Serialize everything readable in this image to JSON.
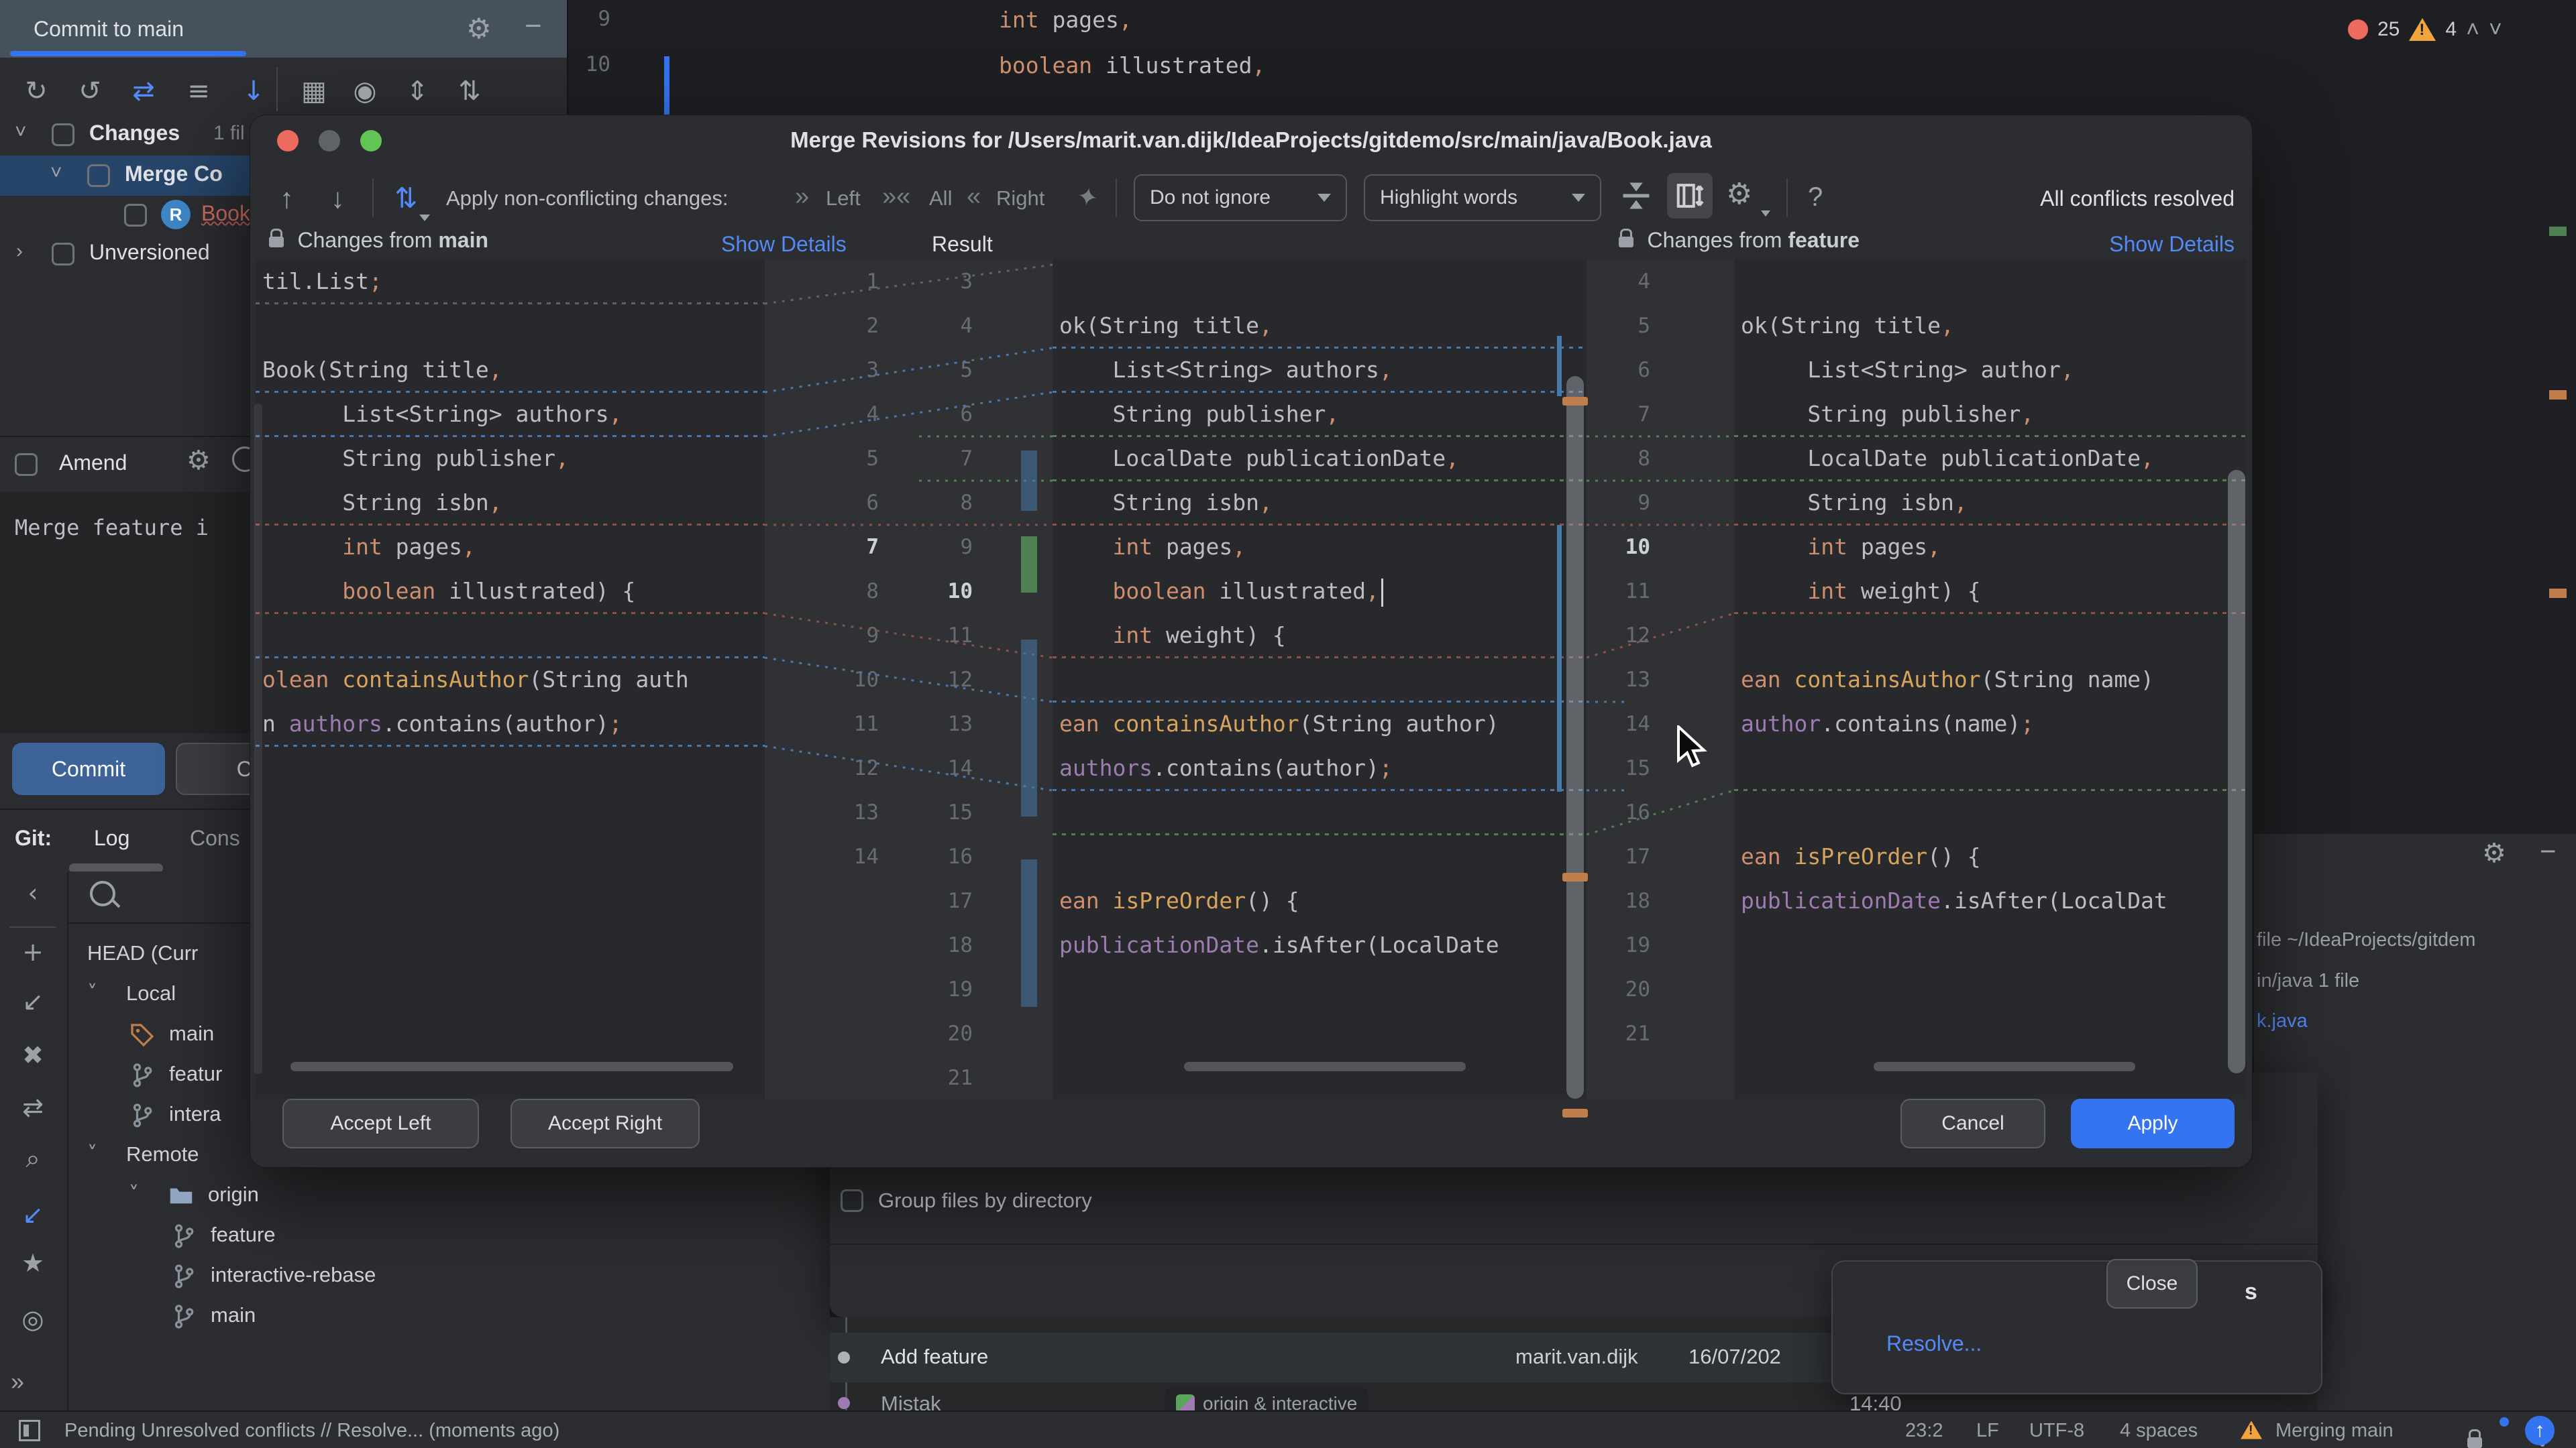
{
  "accent": {
    "blue": "#3574F0",
    "link": "#548AF7",
    "error_red": "#EC6A5E",
    "warning_yellow": "#F2A53D",
    "diff_blue": "#4878A8",
    "diff_green": "#4E8052",
    "diff_red": "#8A5248",
    "conflict_file": "#CF6A62"
  },
  "ide": {
    "commit_panel": {
      "tab_title": "Commit to main",
      "toolbar_icons": [
        "refresh-icon",
        "undo-icon",
        "merge-icon",
        "diff-file-icon",
        "download-icon",
        "grid-icon",
        "target-icon",
        "expand-all-icon",
        "collapse-all-icon"
      ],
      "changes_tree": {
        "root_label": "Changes",
        "root_count": "1 fil",
        "merge_group_label": "Merge Co",
        "conflict_file_label": "Book",
        "unversioned_label": "Unversioned"
      },
      "amend_label": "Amend",
      "commit_message": "Merge feature i",
      "commit_button": "Commit",
      "commit_secondary_button": "Con"
    },
    "git_bar": {
      "prefix": "Git:",
      "tab_log": "Log",
      "tab_console": "Cons"
    },
    "branches": {
      "items": [
        {
          "label": "HEAD (Curr",
          "icon": "none",
          "chev": false,
          "lvl": 1
        },
        {
          "label": "Local",
          "icon": "none",
          "chev": true,
          "lvl": 1
        },
        {
          "label": "main",
          "icon": "tag-icon",
          "chev": false,
          "lvl": 2
        },
        {
          "label": "featur",
          "icon": "branch-icon",
          "chev": false,
          "lvl": 2
        },
        {
          "label": "intera",
          "icon": "branch-icon",
          "chev": false,
          "lvl": 2
        },
        {
          "label": "Remote",
          "icon": "none",
          "chev": true,
          "lvl": 1
        },
        {
          "label": "origin",
          "icon": "folder-icon",
          "chev": true,
          "lvl": 2
        },
        {
          "label": "feature",
          "icon": "branch-icon",
          "chev": false,
          "lvl": 3
        },
        {
          "label": "interactive-rebase",
          "icon": "branch-icon",
          "chev": false,
          "lvl": 3
        },
        {
          "label": "main",
          "icon": "branch-icon",
          "chev": false,
          "lvl": 3
        }
      ]
    },
    "editor_behind": {
      "lines": [
        {
          "num": "9",
          "tokens": [
            [
              "k",
              "int"
            ],
            [
              "t",
              " pages"
            ],
            [
              "p",
              ","
            ]
          ]
        },
        {
          "num": "10",
          "tokens": [
            [
              "k",
              "boolean"
            ],
            [
              "t",
              " illustrated"
            ],
            [
              "p",
              ","
            ]
          ]
        }
      ]
    },
    "problems_widget": {
      "errors": "25",
      "warnings": "4"
    },
    "right_panel": {
      "line1": "file ~/IdeaProjects/gitdem",
      "line2": "in/java 1 file",
      "line3": "k.java"
    },
    "conflicts_dialog": {
      "group_checkbox_label": "Group files by directory",
      "close_button": "Close"
    },
    "log": {
      "row1": {
        "message": "Add feature",
        "author": "marit.van.dijk",
        "date": "16/07/202"
      },
      "row2": {
        "message": "Mistak",
        "pill_label": "origin & interactive",
        "time": "14:40"
      }
    },
    "balloon": {
      "header_fragment": "s",
      "resolve_link": "Resolve..."
    },
    "status_bar": {
      "left_text": "Pending Unresolved conflicts // Resolve... (moments ago)",
      "caret_pos": "23:2",
      "line_ending": "LF",
      "encoding": "UTF-8",
      "indent": "4 spaces",
      "branch_state": "Merging main"
    }
  },
  "dialog": {
    "title": "Merge Revisions for /Users/marit.van.dijk/IdeaProjects/gitdemo/src/main/java/Book.java",
    "toolbar": {
      "apply_label": "Apply non-conflicting changes:",
      "apply_left": "Left",
      "apply_all": "All",
      "apply_right": "Right",
      "ignore_combo_value": "Do not ignore",
      "highlight_combo_value": "Highlight words",
      "help_label": "?",
      "status_text": "All conflicts resolved"
    },
    "headers": {
      "left_label": "Changes from ",
      "left_branch": "main",
      "left_link": "Show Details",
      "center_label": "Result",
      "right_label": "Changes from ",
      "right_branch": "feature",
      "right_link": "Show Details"
    },
    "buttons": {
      "accept_left": "Accept Left",
      "accept_right": "Accept Right",
      "cancel": "Cancel",
      "apply": "Apply"
    },
    "gutter1_col1": [
      "1",
      "2",
      "3",
      "4",
      "5",
      "6",
      "7",
      "8",
      "9",
      "10",
      "11",
      "12",
      "13",
      "14"
    ],
    "gutter1_col1_bold": "7",
    "gutter1_col2": [
      "3",
      "4",
      "5",
      "6",
      "7",
      "8",
      "9",
      "10",
      "11",
      "12",
      "13",
      "14",
      "15",
      "16",
      "17",
      "18",
      "19",
      "20",
      "21"
    ],
    "gutter1_col2_bold": "10",
    "gutter2": [
      "4",
      "5",
      "6",
      "7",
      "8",
      "9",
      "10",
      "11",
      "12",
      "13",
      "14",
      "15",
      "16",
      "17",
      "18",
      "19",
      "20",
      "21"
    ],
    "gutter2_bold": "10",
    "code": {
      "left": {
        "rows": [
          {
            "r": 1,
            "t": [
              [
                "t",
                "til.List"
              ],
              [
                "p",
                ";"
              ]
            ]
          },
          {
            "r": 3,
            "t": [
              [
                "t",
                "Book(String title"
              ],
              [
                "p",
                ","
              ]
            ]
          },
          {
            "r": 4,
            "t": [
              [
                "t",
                "      List<String> authors"
              ],
              [
                "p",
                ","
              ]
            ]
          },
          {
            "r": 5,
            "t": [
              [
                "t",
                "      String publisher"
              ],
              [
                "p",
                ","
              ]
            ]
          },
          {
            "r": 6,
            "t": [
              [
                "t",
                "      String isbn"
              ],
              [
                "p",
                ","
              ]
            ]
          },
          {
            "r": 7,
            "t": [
              [
                "k",
                "      int"
              ],
              [
                "t",
                " pages"
              ],
              [
                "p",
                ","
              ]
            ]
          },
          {
            "r": 8,
            "t": [
              [
                "k",
                "      boolean"
              ],
              [
                "t",
                " illustrated) {"
              ]
            ]
          },
          {
            "r": 10,
            "t": [
              [
                "k",
                "olean "
              ],
              [
                "m",
                "containsAuthor"
              ],
              [
                "t",
                "(String auth"
              ]
            ]
          },
          {
            "r": 11,
            "t": [
              [
                "t",
                "n "
              ],
              [
                "f",
                "authors"
              ],
              [
                "t",
                ".contains(author)"
              ],
              [
                "p",
                ";"
              ]
            ]
          }
        ],
        "seps": [
          [
            1,
            "g"
          ],
          [
            3,
            "b"
          ],
          [
            4,
            "b"
          ],
          [
            6,
            "r"
          ],
          [
            8,
            "r"
          ],
          [
            9,
            "b"
          ],
          [
            11,
            "b"
          ]
        ]
      },
      "mid": {
        "rows": [
          {
            "r": 2,
            "t": [
              [
                "t",
                "ok(String title"
              ],
              [
                "p",
                ","
              ]
            ]
          },
          {
            "r": 3,
            "t": [
              [
                "t",
                "    List<String> authors"
              ],
              [
                "p",
                ","
              ]
            ]
          },
          {
            "r": 4,
            "t": [
              [
                "t",
                "    String publisher"
              ],
              [
                "p",
                ","
              ]
            ]
          },
          {
            "r": 5,
            "t": [
              [
                "t",
                "    LocalDate publicationDate"
              ],
              [
                "p",
                ","
              ]
            ]
          },
          {
            "r": 6,
            "t": [
              [
                "t",
                "    String isbn"
              ],
              [
                "p",
                ","
              ]
            ]
          },
          {
            "r": 7,
            "t": [
              [
                "k",
                "    int"
              ],
              [
                "t",
                " pages"
              ],
              [
                "p",
                ","
              ]
            ]
          },
          {
            "r": 8,
            "t": [
              [
                "k",
                "    boolean"
              ],
              [
                "t",
                " illustrated"
              ],
              [
                "p",
                ","
              ]
            ],
            "caret": true
          },
          {
            "r": 9,
            "t": [
              [
                "k",
                "    int"
              ],
              [
                "t",
                " weight) {"
              ]
            ]
          },
          {
            "r": 11,
            "t": [
              [
                "k",
                "ean "
              ],
              [
                "m",
                "containsAuthor"
              ],
              [
                "t",
                "(String author)"
              ]
            ]
          },
          {
            "r": 12,
            "t": [
              [
                "f",
                "authors"
              ],
              [
                "t",
                ".contains(author)"
              ],
              [
                "p",
                ";"
              ]
            ]
          },
          {
            "r": 15,
            "t": [
              [
                "k",
                "ean "
              ],
              [
                "m",
                "isPreOrder"
              ],
              [
                "t",
                "() {"
              ]
            ]
          },
          {
            "r": 16,
            "t": [
              [
                "f",
                "publicationDate"
              ],
              [
                "t",
                ".isAfter(LocalDate"
              ]
            ]
          }
        ],
        "seps": [
          [
            2,
            "b"
          ],
          [
            3,
            "b"
          ],
          [
            4,
            "gr"
          ],
          [
            5,
            "gr"
          ],
          [
            6,
            "r"
          ],
          [
            9,
            "r"
          ],
          [
            10,
            "b"
          ],
          [
            12,
            "b"
          ],
          [
            13,
            "gr"
          ]
        ]
      },
      "right": {
        "rows": [
          {
            "r": 2,
            "t": [
              [
                "t",
                "ok(String title"
              ],
              [
                "p",
                ","
              ]
            ]
          },
          {
            "r": 3,
            "t": [
              [
                "t",
                "     List<String> author"
              ],
              [
                "p",
                ","
              ]
            ]
          },
          {
            "r": 4,
            "t": [
              [
                "t",
                "     String publisher"
              ],
              [
                "p",
                ","
              ]
            ]
          },
          {
            "r": 5,
            "t": [
              [
                "t",
                "     LocalDate publicationDate"
              ],
              [
                "p",
                ","
              ]
            ]
          },
          {
            "r": 6,
            "t": [
              [
                "t",
                "     String isbn"
              ],
              [
                "p",
                ","
              ]
            ]
          },
          {
            "r": 7,
            "t": [
              [
                "k",
                "     int"
              ],
              [
                "t",
                " pages"
              ],
              [
                "p",
                ","
              ]
            ]
          },
          {
            "r": 8,
            "t": [
              [
                "k",
                "     int"
              ],
              [
                "t",
                " weight) {"
              ]
            ]
          },
          {
            "r": 10,
            "t": [
              [
                "k",
                "ean "
              ],
              [
                "m",
                "containsAuthor"
              ],
              [
                "t",
                "(String name)"
              ]
            ]
          },
          {
            "r": 11,
            "t": [
              [
                "f",
                "author"
              ],
              [
                "t",
                ".contains(name)"
              ],
              [
                "p",
                ";"
              ]
            ]
          },
          {
            "r": 14,
            "t": [
              [
                "k",
                "ean "
              ],
              [
                "m",
                "isPreOrder"
              ],
              [
                "t",
                "() {"
              ]
            ]
          },
          {
            "r": 15,
            "t": [
              [
                "f",
                "publicationDate"
              ],
              [
                "t",
                ".isAfter(LocalDat"
              ]
            ]
          }
        ],
        "seps": [
          [
            4,
            "gr"
          ],
          [
            5,
            "gr"
          ],
          [
            6,
            "r"
          ],
          [
            8,
            "r"
          ],
          [
            12,
            "gr"
          ]
        ]
      }
    }
  }
}
